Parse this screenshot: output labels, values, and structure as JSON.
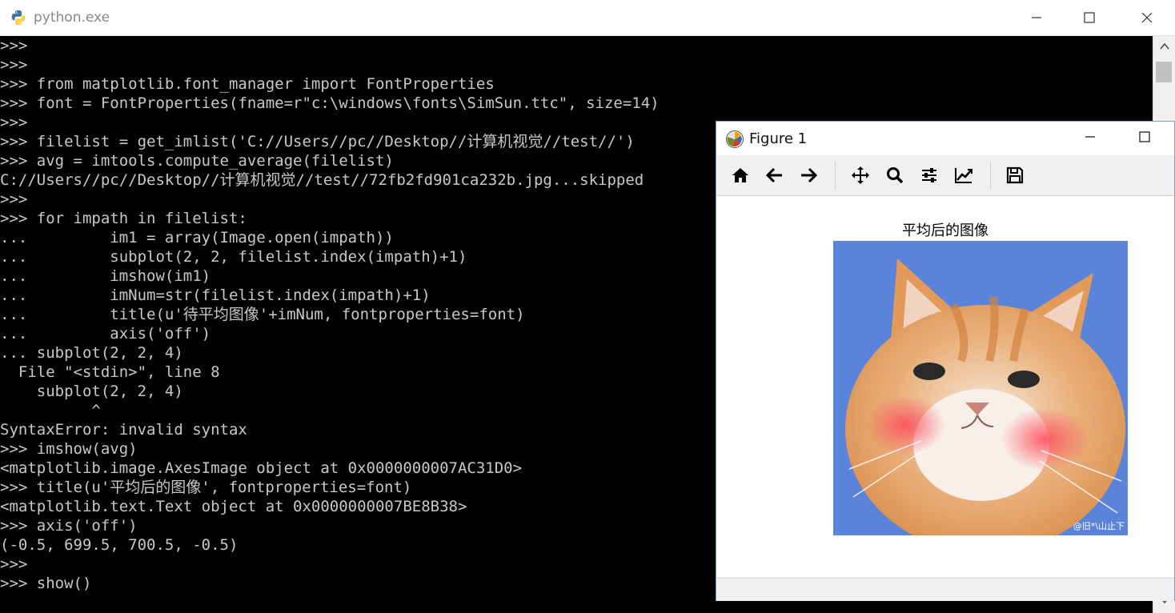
{
  "window": {
    "title": "python.exe",
    "minimize": "—",
    "maximize": "☐",
    "close": "✕"
  },
  "console": {
    "lines": [
      ">>>",
      ">>>",
      ">>> from matplotlib.font_manager import FontProperties",
      ">>> font = FontProperties(fname=r\"c:\\windows\\fonts\\SimSun.ttc\", size=14)",
      ">>>",
      ">>> filelist = get_imlist('C://Users//pc//Desktop//计算机视觉//test//')",
      ">>> avg = imtools.compute_average(filelist)",
      "C://Users//pc//Desktop//计算机视觉//test//72fb2fd901ca232b.jpg...skipped",
      ">>>",
      ">>> for impath in filelist:",
      "...         im1 = array(Image.open(impath))",
      "...         subplot(2, 2, filelist.index(impath)+1)",
      "...         imshow(im1)",
      "...         imNum=str(filelist.index(impath)+1)",
      "...         title(u'待平均图像'+imNum, fontproperties=font)",
      "...         axis('off')",
      "... subplot(2, 2, 4)",
      "  File \"<stdin>\", line 8",
      "    subplot(2, 2, 4)",
      "          ^",
      "SyntaxError: invalid syntax",
      ">>> imshow(avg)",
      "<matplotlib.image.AxesImage object at 0x0000000007AC31D0>",
      ">>> title(u'平均后的图像', fontproperties=font)",
      "<matplotlib.text.Text object at 0x0000000007BE8B38>",
      ">>> axis('off')",
      "(-0.5, 699.5, 700.5, -0.5)",
      ">>>",
      ">>> show()"
    ]
  },
  "figure": {
    "title": "Figure 1",
    "minimize": "—",
    "maximize": "☐",
    "plot_title": "平均后的图像",
    "watermark": "@旧*\\山止下",
    "toolbar": [
      {
        "name": "home-icon"
      },
      {
        "name": "back-icon"
      },
      {
        "name": "forward-icon"
      },
      {
        "name": "pan-icon"
      },
      {
        "name": "zoom-icon"
      },
      {
        "name": "configure-subplots-icon"
      },
      {
        "name": "edit-axis-icon"
      },
      {
        "name": "save-icon"
      }
    ]
  },
  "colors": {
    "console_bg": "#000000",
    "console_text": "#c8c8c8",
    "image_bg": "#5a84d9"
  }
}
